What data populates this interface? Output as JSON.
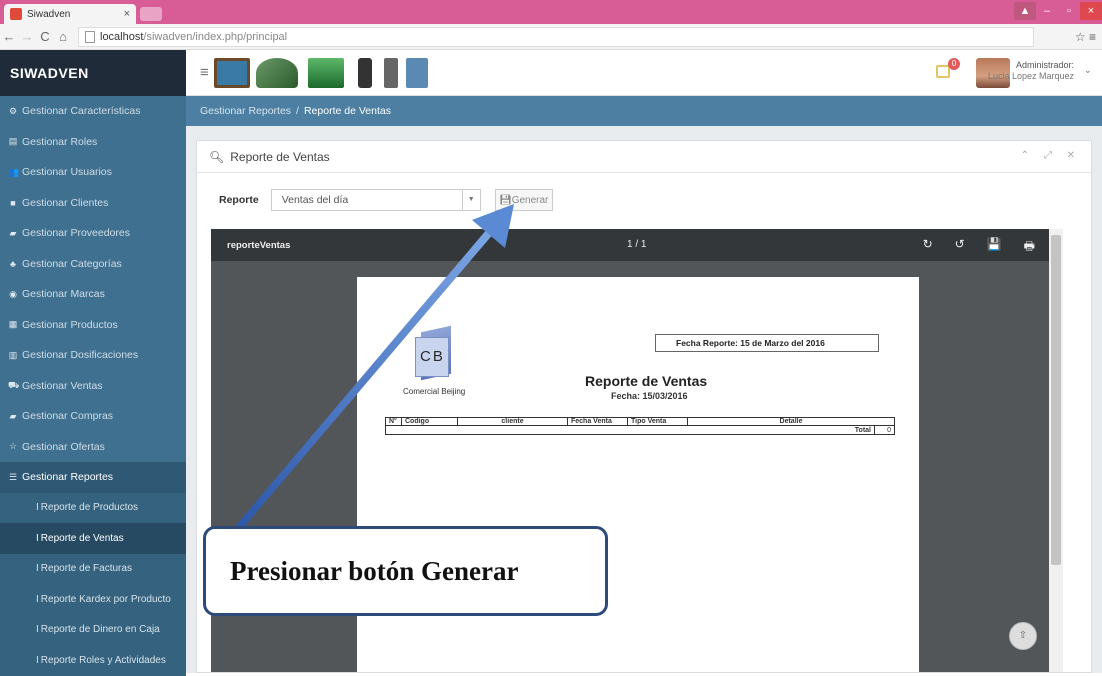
{
  "browser": {
    "tab_title": "Siwadven",
    "tab_close": "×",
    "url_host": "localhost",
    "url_path": "/siwadven/index.php/principal",
    "controls": {
      "min": "–",
      "max": "▫",
      "close": "×"
    }
  },
  "header": {
    "brand": "SIWADVEN",
    "notification_count": "0",
    "user_role": "Administrador:",
    "user_name": "Lucia Lopez Marquez"
  },
  "sidebar": {
    "items": [
      {
        "icon": "cogs-icon",
        "glyph": "⚙",
        "label": "Gestionar Características"
      },
      {
        "icon": "roles-icon",
        "glyph": "▤",
        "label": "Gestionar Roles"
      },
      {
        "icon": "users-icon",
        "glyph": "👥",
        "label": "Gestionar Usuarios"
      },
      {
        "icon": "clients-icon",
        "glyph": "■",
        "label": "Gestionar Clientes"
      },
      {
        "icon": "truck-icon",
        "glyph": "▰",
        "label": "Gestionar Proveedores"
      },
      {
        "icon": "sitemap-icon",
        "glyph": "♣",
        "label": "Gestionar Categorías"
      },
      {
        "icon": "brand-icon",
        "glyph": "◉",
        "label": "Gestionar Marcas"
      },
      {
        "icon": "products-icon",
        "glyph": "▦",
        "label": "Gestionar Productos"
      },
      {
        "icon": "dosage-icon",
        "glyph": "▥",
        "label": "Gestionar Dosificaciones"
      },
      {
        "icon": "cart-icon",
        "glyph": "⛟",
        "label": "Gestionar Ventas"
      },
      {
        "icon": "purchase-icon",
        "glyph": "▰",
        "label": "Gestionar Compras"
      },
      {
        "icon": "star-icon",
        "glyph": "☆",
        "label": "Gestionar Ofertas"
      },
      {
        "icon": "reports-icon",
        "glyph": "☰",
        "label": "Gestionar Reportes"
      }
    ],
    "subitems": [
      "Reporte de Productos",
      "Reporte de Ventas",
      "Reporte de Facturas",
      "Reporte Kardex por Producto",
      "Reporte de Dinero en Caja",
      "Reporte Roles y Actividades"
    ]
  },
  "breadcrumb": {
    "parent": "Gestionar Reportes",
    "separator": "/",
    "current": "Reporte de Ventas"
  },
  "panel": {
    "title": "Reporte de Ventas",
    "tools": "⌃ ⤢ ✕",
    "report_label": "Reporte",
    "report_select_value": "Ventas del día",
    "generate_button": "Generar"
  },
  "viewer": {
    "filename": "reporteVentas",
    "pages": "1 / 1",
    "tools": [
      "↻",
      "↺",
      "💾",
      "🖶"
    ]
  },
  "report": {
    "logo_text": "CB",
    "company": "Comercial Beijing",
    "fecha_reporte": "Fecha Reporte: 15 de Marzo del 2016",
    "title": "Reporte de Ventas",
    "fecha": "Fecha: 15/03/2016",
    "columns": [
      "N°",
      "Codigo",
      "cliente",
      "Fecha Venta",
      "Tipo Venta",
      "Detalle"
    ],
    "total_label": "Total",
    "total_value": "0"
  },
  "annotation": {
    "callout_text": "Presionar botón Generar"
  }
}
